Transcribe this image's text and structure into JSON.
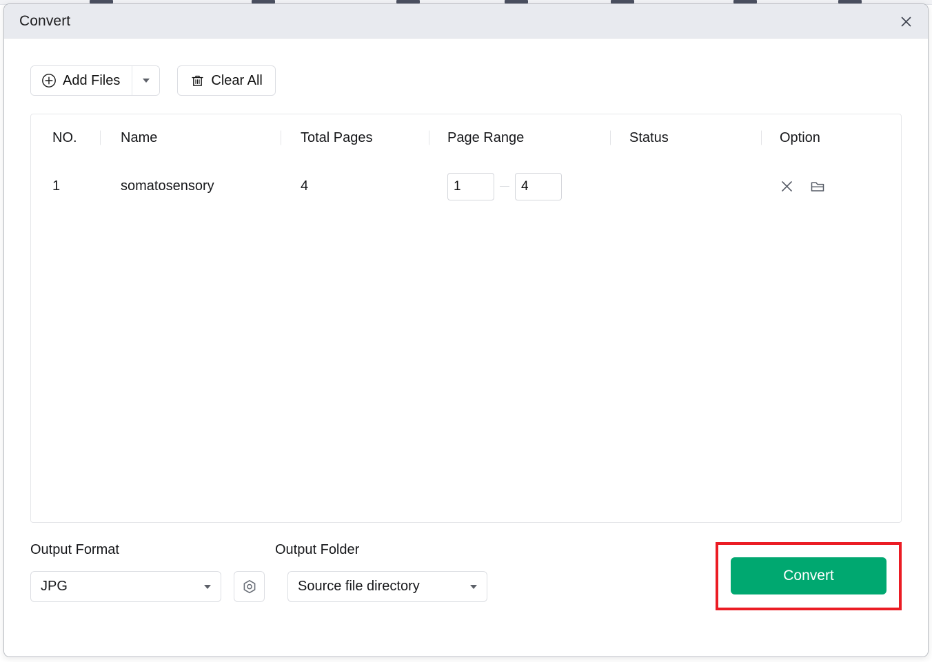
{
  "window": {
    "title": "Convert",
    "close_icon": "close-icon"
  },
  "toolbar": {
    "add_files_label": "Add Files",
    "add_files_icon": "circle-plus-icon",
    "add_files_dropdown_icon": "chevron-down-icon",
    "clear_all_label": "Clear All",
    "clear_all_icon": "trash-icon"
  },
  "file_table": {
    "columns": [
      "NO.",
      "Name",
      "Total Pages",
      "Page Range",
      "Status",
      "Option"
    ],
    "rows": [
      {
        "no": "1",
        "name": "somatosensory",
        "total_pages": "4",
        "page_range_from": "1",
        "page_range_to": "4",
        "status": "",
        "option_remove_icon": "close-icon",
        "option_folder_icon": "folder-icon"
      }
    ]
  },
  "footer": {
    "output_format_label": "Output Format",
    "output_format_value": "JPG",
    "output_format_caret": "chevron-down-icon",
    "settings_icon": "hexagon-settings-icon",
    "output_folder_label": "Output Folder",
    "output_folder_value": "Source file directory",
    "output_folder_caret": "chevron-down-icon",
    "convert_label": "Convert"
  },
  "colors": {
    "accent_green": "#00a870",
    "annotation_red": "#eb1c24",
    "titlebar": "#e8eaef"
  }
}
